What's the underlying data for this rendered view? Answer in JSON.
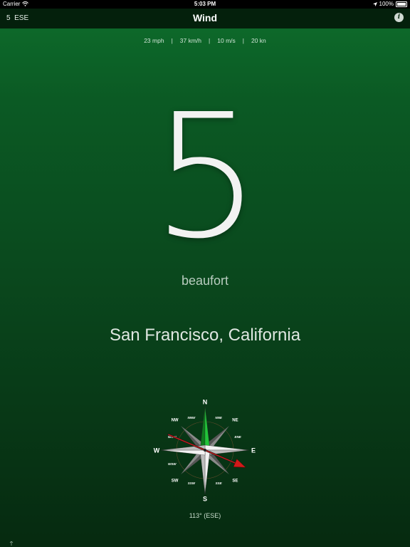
{
  "status_bar": {
    "carrier": "Carrier",
    "time": "5:03 PM",
    "battery": "100%"
  },
  "nav": {
    "left_label": "5  ESE",
    "title": "Wind",
    "info_label": "i"
  },
  "units": [
    "23 mph",
    "37 km/h",
    "10 m/s",
    "20 kn"
  ],
  "beaufort": {
    "value": "5",
    "label": "beaufort"
  },
  "location": "San Francisco, California",
  "compass": {
    "points": [
      "N",
      "NNE",
      "NE",
      "ENE",
      "E",
      "ESE",
      "SE",
      "SSE",
      "S",
      "SSW",
      "SW",
      "WSW",
      "W",
      "WNW",
      "NW",
      "NNW"
    ],
    "bearing_deg": 113,
    "bearing_text": "113° (ESE)",
    "north_needle_color": "#22c43a",
    "arrow_color": "#d11a1a"
  }
}
